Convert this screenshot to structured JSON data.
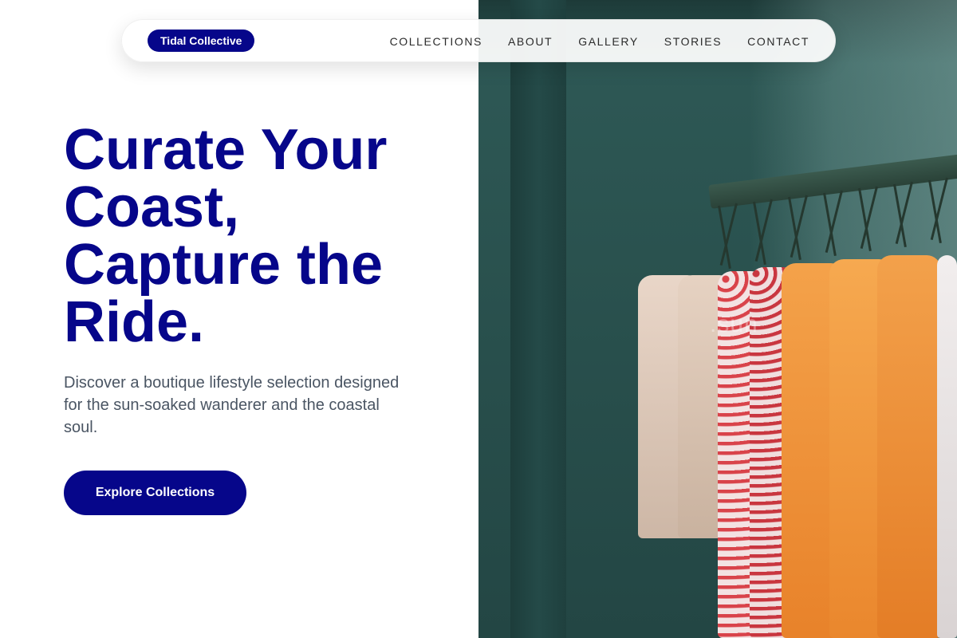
{
  "brand": {
    "name": "Tidal Collective",
    "accent_color": "#06068a"
  },
  "nav": {
    "items": [
      {
        "label": "COLLECTIONS"
      },
      {
        "label": "ABOUT"
      },
      {
        "label": "GALLERY"
      },
      {
        "label": "STORIES"
      },
      {
        "label": "CONTACT"
      }
    ]
  },
  "hero": {
    "title": "Curate Your Coast, Capture the Ride.",
    "subtitle": "Discover a boutique lifestyle selection designed for the sun-soaked wanderer and the coastal soul.",
    "cta_label": "Explore Collections"
  },
  "photo": {
    "subject": "clothing-rack-photo",
    "watermark": ".sun"
  }
}
